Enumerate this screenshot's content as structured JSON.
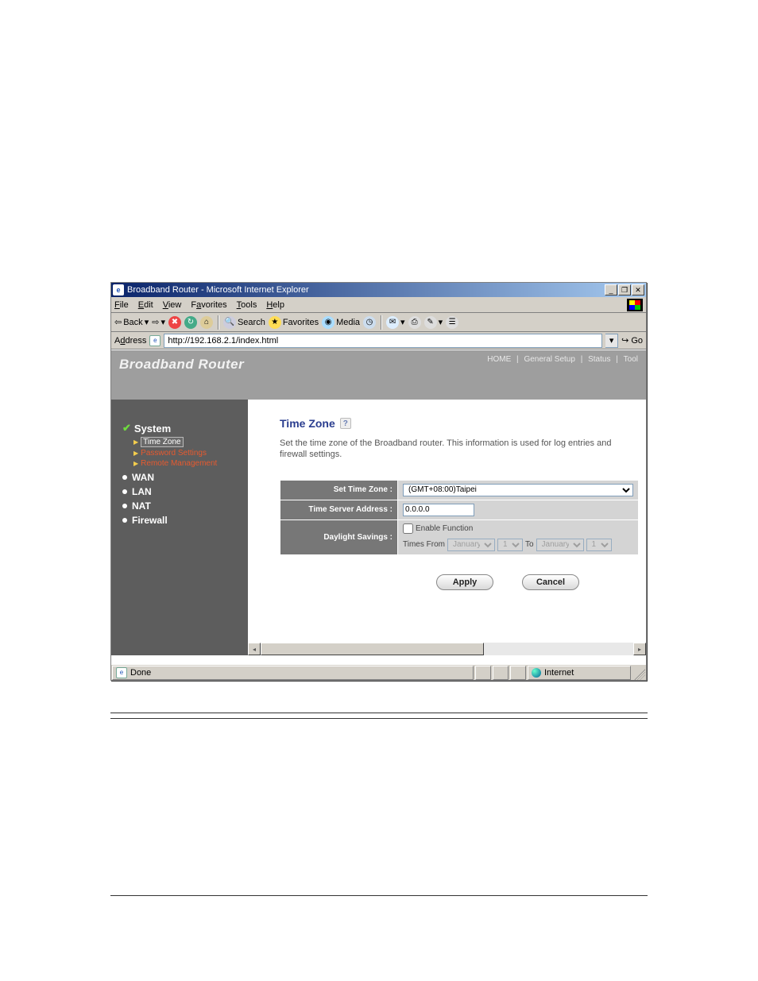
{
  "window": {
    "title": "Broadband Router - Microsoft Internet Explorer"
  },
  "menubar": {
    "file": "File",
    "edit": "Edit",
    "view": "View",
    "favorites": "Favorites",
    "tools": "Tools",
    "help": "Help"
  },
  "toolbar": {
    "back": "Back",
    "search": "Search",
    "favorites": "Favorites",
    "media": "Media"
  },
  "addressbar": {
    "label": "Address",
    "url": "http://192.168.2.1/index.html",
    "go": "Go"
  },
  "router": {
    "brand": "Broadband Router",
    "toplinks": {
      "home": "HOME",
      "setup": "General Setup",
      "status": "Status",
      "tool": "Tool"
    }
  },
  "sidebar": {
    "system": "System",
    "time_zone": "Time Zone",
    "password_settings": "Password Settings",
    "remote_management": "Remote Management",
    "wan": "WAN",
    "lan": "LAN",
    "nat": "NAT",
    "firewall": "Firewall"
  },
  "page": {
    "title": "Time Zone",
    "desc": "Set the time zone of the Broadband router. This information is used for log entries and firewall settings.",
    "labels": {
      "set_tz": "Set Time Zone :",
      "time_server": "Time Server Address :",
      "daylight": "Daylight Savings :"
    },
    "tz_value": "(GMT+08:00)Taipei",
    "ts_value": "0.0.0.0",
    "ds": {
      "enable_label": "Enable Function",
      "times_from": "Times From",
      "to": "To",
      "from_month": "January",
      "from_day": "1",
      "to_month": "January",
      "to_day": "1"
    },
    "buttons": {
      "apply": "Apply",
      "cancel": "Cancel"
    }
  },
  "statusbar": {
    "done": "Done",
    "zone": "Internet"
  }
}
